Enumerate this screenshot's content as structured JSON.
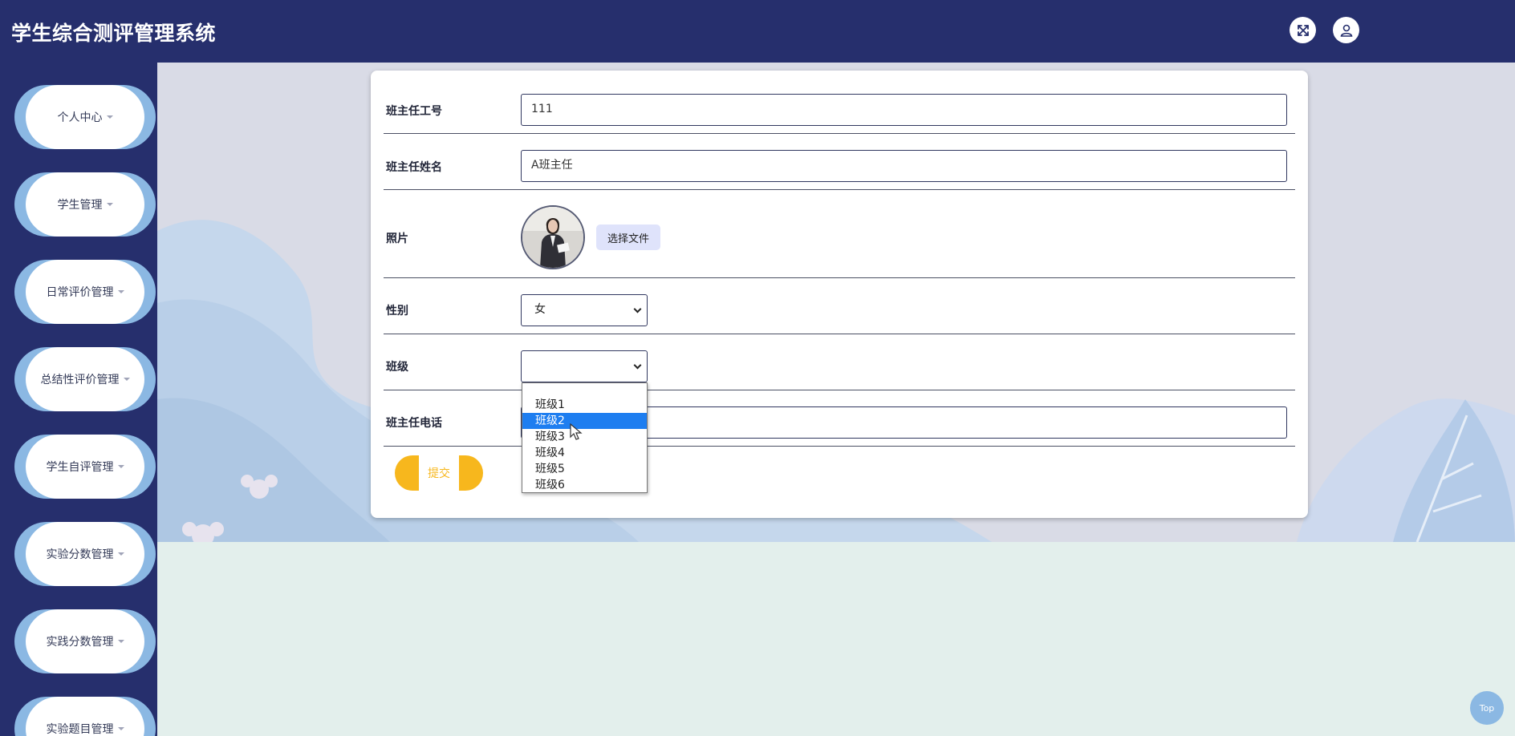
{
  "header": {
    "title": "学生综合测评管理系统",
    "icons": [
      "fullscreen-icon",
      "user-icon"
    ]
  },
  "sidebar": {
    "items": [
      {
        "label": "个人中心"
      },
      {
        "label": "学生管理"
      },
      {
        "label": "日常评价管理"
      },
      {
        "label": "总结性评价管理"
      },
      {
        "label": "学生自评管理"
      },
      {
        "label": "实验分数管理"
      },
      {
        "label": "实践分数管理"
      },
      {
        "label": "实验题目管理"
      }
    ]
  },
  "form": {
    "teacher_id_label": "班主任工号",
    "teacher_id_value": "111",
    "teacher_name_label": "班主任姓名",
    "teacher_name_value": "A班主任",
    "photo_label": "照片",
    "file_button": "选择文件",
    "gender_label": "性别",
    "gender_value": "女",
    "class_label": "班级",
    "class_value": "",
    "phone_label": "班主任电话",
    "phone_value": "",
    "submit_label": "提交"
  },
  "dropdown": {
    "options": [
      "",
      "班级1",
      "班级2",
      "班级3",
      "班级4",
      "班级5",
      "班级6"
    ],
    "highlighted": "班级2"
  },
  "back_to_top": "Top",
  "colors": {
    "header_bg": "#262f6d",
    "accent_blue": "#8bb8e3",
    "submit_yellow": "#f7b71d",
    "option_highlight": "#1e7ef0"
  }
}
